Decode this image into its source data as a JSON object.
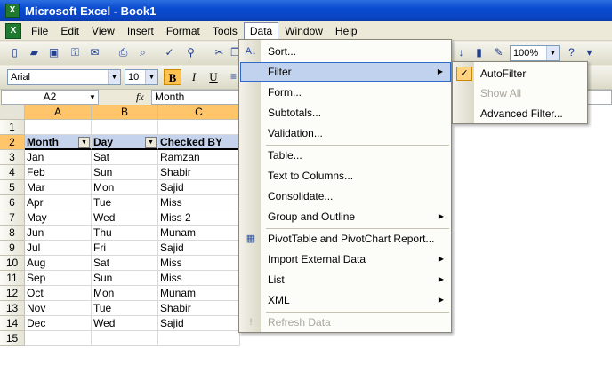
{
  "window": {
    "title": "Microsoft Excel - Book1",
    "app_icon": "excel-icon"
  },
  "menubar": {
    "items": [
      {
        "label": "File"
      },
      {
        "label": "Edit"
      },
      {
        "label": "View"
      },
      {
        "label": "Insert"
      },
      {
        "label": "Format"
      },
      {
        "label": "Tools"
      },
      {
        "label": "Data"
      },
      {
        "label": "Window"
      },
      {
        "label": "Help"
      }
    ],
    "active": "Data"
  },
  "toolbar": {
    "font_name": "Arial",
    "font_size": "10",
    "zoom": "100%",
    "bold": "B",
    "italic": "I",
    "underline": "U"
  },
  "formula_bar": {
    "name_box": "A2",
    "fx_label": "fx",
    "formula": "Month"
  },
  "grid": {
    "columns": [
      "A",
      "B",
      "C"
    ],
    "rows": [
      "1",
      "2",
      "3",
      "4",
      "5",
      "6",
      "7",
      "8",
      "9",
      "10",
      "11",
      "12",
      "13",
      "14",
      "15"
    ],
    "header_row": [
      "Month",
      "Day",
      "Checked BY"
    ],
    "data": [
      [
        "Jan",
        "Sat",
        "Ramzan"
      ],
      [
        "Feb",
        "Sun",
        "Shabir"
      ],
      [
        "Mar",
        "Mon",
        "Sajid"
      ],
      [
        "Apr",
        "Tue",
        "Miss"
      ],
      [
        "May",
        "Wed",
        "Miss 2"
      ],
      [
        "Jun",
        "Thu",
        "Munam"
      ],
      [
        "Jul",
        "Fri",
        "Sajid"
      ],
      [
        "Aug",
        "Sat",
        "Miss"
      ],
      [
        "Sep",
        "Sun",
        "Miss"
      ],
      [
        "Oct",
        "Mon",
        "Munam"
      ],
      [
        "Nov",
        "Tue",
        "Shabir"
      ],
      [
        "Dec",
        "Wed",
        "Sajid"
      ]
    ]
  },
  "data_menu": {
    "items": [
      {
        "label": "Sort...",
        "icon": "sort-ascending-icon"
      },
      {
        "label": "Filter",
        "submenu": true,
        "highlighted": true
      },
      {
        "label": "Form..."
      },
      {
        "label": "Subtotals..."
      },
      {
        "label": "Validation..."
      },
      {
        "label": "Table..."
      },
      {
        "label": "Text to Columns..."
      },
      {
        "label": "Consolidate..."
      },
      {
        "label": "Group and Outline",
        "submenu": true
      },
      {
        "label": "PivotTable and PivotChart Report...",
        "icon": "pivot-table-icon"
      },
      {
        "label": "Import External Data",
        "submenu": true
      },
      {
        "label": "List",
        "submenu": true
      },
      {
        "label": "XML",
        "submenu": true
      },
      {
        "label": "Refresh Data",
        "disabled": true,
        "icon": "refresh-icon"
      }
    ]
  },
  "filter_submenu": {
    "items": [
      {
        "label": "AutoFilter",
        "checked": true
      },
      {
        "label": "Show All",
        "disabled": true
      },
      {
        "label": "Advanced Filter..."
      }
    ]
  }
}
